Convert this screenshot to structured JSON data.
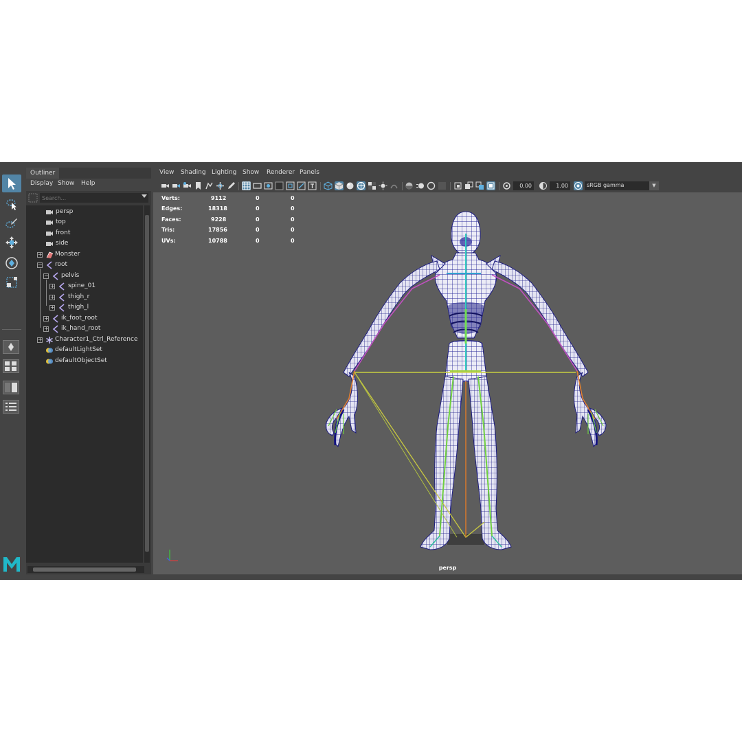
{
  "outliner": {
    "tab": "Outliner",
    "menu": [
      "Display",
      "Show",
      "Help"
    ],
    "search_placeholder": "Search...",
    "items": [
      {
        "label": "persp",
        "type": "camera"
      },
      {
        "label": "top",
        "type": "camera"
      },
      {
        "label": "front",
        "type": "camera"
      },
      {
        "label": "side",
        "type": "camera"
      },
      {
        "label": "Monster",
        "type": "mesh"
      },
      {
        "label": "root",
        "type": "joint"
      },
      {
        "label": "pelvis",
        "type": "joint"
      },
      {
        "label": "spine_01",
        "type": "joint"
      },
      {
        "label": "thigh_r",
        "type": "joint"
      },
      {
        "label": "thigh_l",
        "type": "joint"
      },
      {
        "label": "ik_foot_root",
        "type": "joint"
      },
      {
        "label": "ik_hand_root",
        "type": "joint"
      },
      {
        "label": "Character1_Ctrl_Reference",
        "type": "reference"
      },
      {
        "label": "defaultLightSet",
        "type": "set"
      },
      {
        "label": "defaultObjectSet",
        "type": "set"
      }
    ]
  },
  "viewport": {
    "menu": [
      "View",
      "Shading",
      "Lighting",
      "Show",
      "Renderer",
      "Panels"
    ],
    "exposure": "0.00",
    "gamma": "1.00",
    "color_space": "sRGB gamma",
    "camera_label": "persp",
    "hud": [
      {
        "label": "Verts:",
        "total": "9112",
        "selected": "0",
        "component": "0"
      },
      {
        "label": "Edges:",
        "total": "18318",
        "selected": "0",
        "component": "0"
      },
      {
        "label": "Faces:",
        "total": "9228",
        "selected": "0",
        "component": "0"
      },
      {
        "label": "Tris:",
        "total": "17856",
        "selected": "0",
        "component": "0"
      },
      {
        "label": "UVs:",
        "total": "10788",
        "selected": "0",
        "component": "0"
      }
    ]
  },
  "toolbox": {
    "tools": [
      "select-tool",
      "lasso-tool",
      "paint-select-tool",
      "move-tool",
      "rotate-tool",
      "scale-tool"
    ],
    "logo": "M"
  },
  "colors": {
    "accent": "#5285a6",
    "panel_bg": "#444444",
    "viewport_bg": "#5d5d5d",
    "mesh_wire": "#2a2a9a",
    "mesh_fill": "#e8e8f4"
  }
}
